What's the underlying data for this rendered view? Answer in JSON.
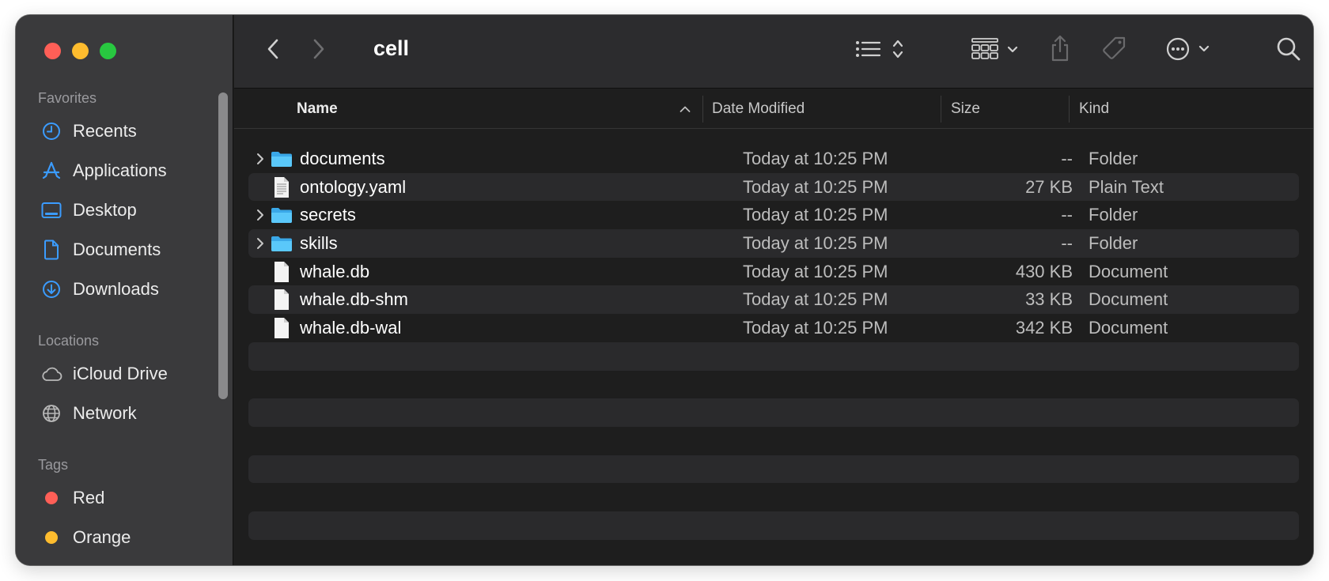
{
  "window": {
    "title": "cell"
  },
  "sidebar": {
    "favorites_heading": "Favorites",
    "favorites": [
      {
        "label": "Recents",
        "icon": "clock-icon"
      },
      {
        "label": "Applications",
        "icon": "applications-icon"
      },
      {
        "label": "Desktop",
        "icon": "desktop-icon"
      },
      {
        "label": "Documents",
        "icon": "document-icon"
      },
      {
        "label": "Downloads",
        "icon": "download-icon"
      }
    ],
    "locations_heading": "Locations",
    "locations": [
      {
        "label": "iCloud Drive",
        "icon": "cloud-icon"
      },
      {
        "label": "Network",
        "icon": "globe-icon"
      }
    ],
    "tags_heading": "Tags",
    "tags": [
      {
        "label": "Red",
        "color": "#ff5f57"
      },
      {
        "label": "Orange",
        "color": "#febc2e"
      }
    ]
  },
  "columns": {
    "name": "Name",
    "date": "Date Modified",
    "size": "Size",
    "kind": "Kind"
  },
  "files": [
    {
      "name": "documents",
      "date": "Today at 10:25 PM",
      "size": "--",
      "kind": "Folder",
      "type": "folder"
    },
    {
      "name": "ontology.yaml",
      "date": "Today at 10:25 PM",
      "size": "27 KB",
      "kind": "Plain Text",
      "type": "text"
    },
    {
      "name": "secrets",
      "date": "Today at 10:25 PM",
      "size": "--",
      "kind": "Folder",
      "type": "folder"
    },
    {
      "name": "skills",
      "date": "Today at 10:25 PM",
      "size": "--",
      "kind": "Folder",
      "type": "folder"
    },
    {
      "name": "whale.db",
      "date": "Today at 10:25 PM",
      "size": "430 KB",
      "kind": "Document",
      "type": "document"
    },
    {
      "name": "whale.db-shm",
      "date": "Today at 10:25 PM",
      "size": "33 KB",
      "kind": "Document",
      "type": "document"
    },
    {
      "name": "whale.db-wal",
      "date": "Today at 10:25 PM",
      "size": "342 KB",
      "kind": "Document",
      "type": "document"
    }
  ],
  "colors": {
    "accent": "#3b9cff",
    "folder": "#5ac8fa"
  }
}
